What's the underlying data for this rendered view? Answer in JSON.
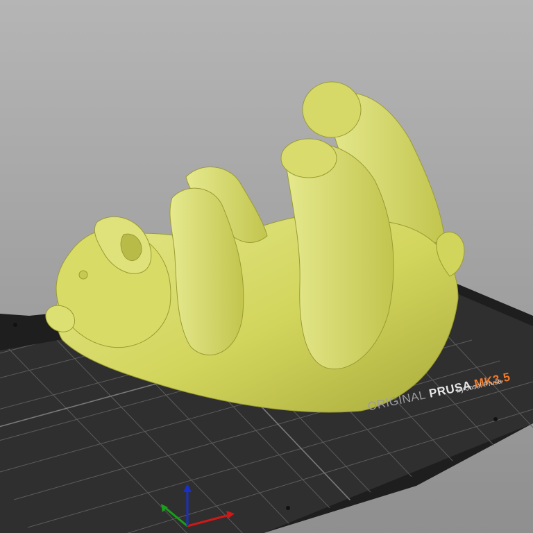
{
  "bed": {
    "brand_prefix": "ORIGINAL",
    "brand_name": "PRUSA",
    "brand_model": "MK3.5",
    "byline": "by Josef Prusa"
  },
  "model": {
    "name_icon": "bear-model",
    "color": "#d8dc6a"
  },
  "axes": {
    "x_color": "#d01818",
    "y_color": "#18a018",
    "z_color": "#1830c8"
  },
  "colors": {
    "background_top": "#b5b5b5",
    "background_bottom": "#8f8f8f",
    "bed_surface": "#2d2d2d",
    "bed_frame": "#1e1e1e",
    "grid_line": "#5a5a5a"
  }
}
